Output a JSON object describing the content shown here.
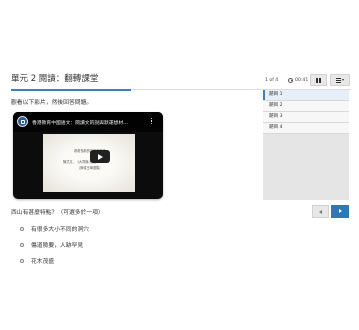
{
  "header": {
    "title": "單元 2 閱讀：翻轉課堂"
  },
  "toolbar": {
    "counter": "1 of 4",
    "timer": "00:41",
    "pause_icon": "pause-icon",
    "list_icon": "list-menu-icon"
  },
  "questions_panel": {
    "items": [
      {
        "label": "題目 1",
        "active": true
      },
      {
        "label": "題目 2",
        "active": false
      },
      {
        "label": "題目 3",
        "active": false
      },
      {
        "label": "題目 4",
        "active": false
      }
    ]
  },
  "main": {
    "instruction": "觀看以下影片，然後回答問題。",
    "video": {
      "title": "香港教育中國語文：閱讀文的說與默運想材…",
      "frame_line1": "看看長新的高中生寫作",
      "frame_line2": "陳式文，《大同與小康》",
      "frame_line3": "（節錄王舉選集）",
      "play_icon": "play-icon"
    },
    "question": "西山有甚麼特點？（可選多於一項）",
    "options": [
      "有很多大小不同的洞穴",
      "傷道險要，人跡罕見",
      "花木茂盛"
    ]
  },
  "navigation": {
    "prev_icon": "chevron-left-icon",
    "next_icon": "chevron-right-icon"
  },
  "colors": {
    "accent": "#2f78b7",
    "progress": "#3a7fc4",
    "panel_bg": "#e5e5e5"
  }
}
